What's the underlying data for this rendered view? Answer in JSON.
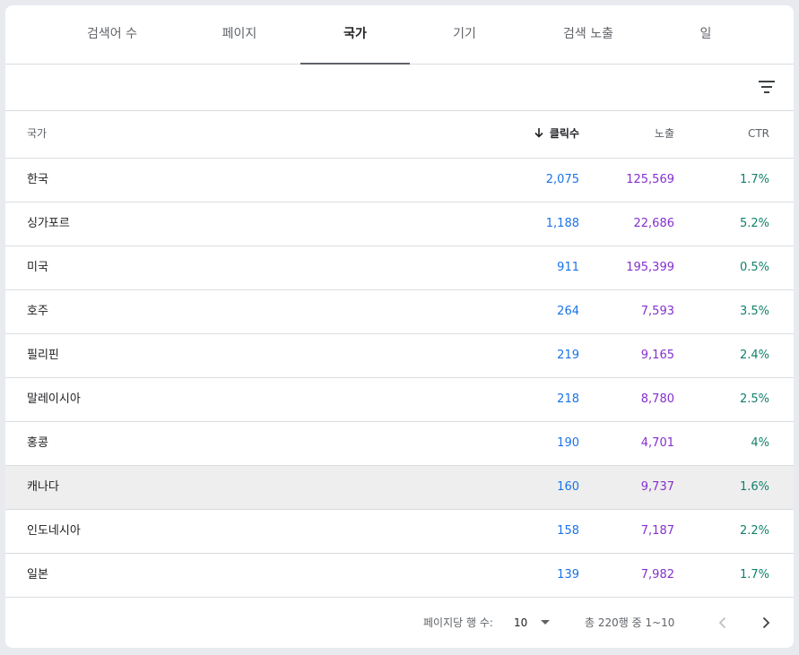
{
  "tabs": [
    {
      "label": "검색어 수"
    },
    {
      "label": "페이지"
    },
    {
      "label": "국가"
    },
    {
      "label": "기기"
    },
    {
      "label": "검색 노출"
    },
    {
      "label": "일"
    }
  ],
  "active_tab": "국가",
  "toolbar": {
    "filter_icon": "filter-icon"
  },
  "table": {
    "headers": {
      "name": "국가",
      "clicks": "클릭수",
      "impressions": "노출",
      "ctr": "CTR"
    },
    "sort": {
      "column": "clicks",
      "direction": "descending",
      "icon": "arrow-down-icon"
    },
    "rows": [
      {
        "name": "한국",
        "clicks": "2,075",
        "impressions": "125,569",
        "ctr": "1.7%"
      },
      {
        "name": "싱가포르",
        "clicks": "1,188",
        "impressions": "22,686",
        "ctr": "5.2%"
      },
      {
        "name": "미국",
        "clicks": "911",
        "impressions": "195,399",
        "ctr": "0.5%"
      },
      {
        "name": "호주",
        "clicks": "264",
        "impressions": "7,593",
        "ctr": "3.5%"
      },
      {
        "name": "필리핀",
        "clicks": "219",
        "impressions": "9,165",
        "ctr": "2.4%"
      },
      {
        "name": "말레이시아",
        "clicks": "218",
        "impressions": "8,780",
        "ctr": "2.5%"
      },
      {
        "name": "홍콩",
        "clicks": "190",
        "impressions": "4,701",
        "ctr": "4%"
      },
      {
        "name": "캐나다",
        "clicks": "160",
        "impressions": "9,737",
        "ctr": "1.6%"
      },
      {
        "name": "인도네시아",
        "clicks": "158",
        "impressions": "7,187",
        "ctr": "2.2%"
      },
      {
        "name": "일본",
        "clicks": "139",
        "impressions": "7,982",
        "ctr": "1.7%"
      }
    ]
  },
  "footer": {
    "rows_per_page_label": "페이지당 행 수:",
    "rows_per_page_value": "10",
    "range_text": "총 220행 중 1~10"
  },
  "colors": {
    "clicks": "#1a73e8",
    "impressions": "#8430ce",
    "ctr": "#12806b",
    "highlight_row": "#eeeeee"
  }
}
